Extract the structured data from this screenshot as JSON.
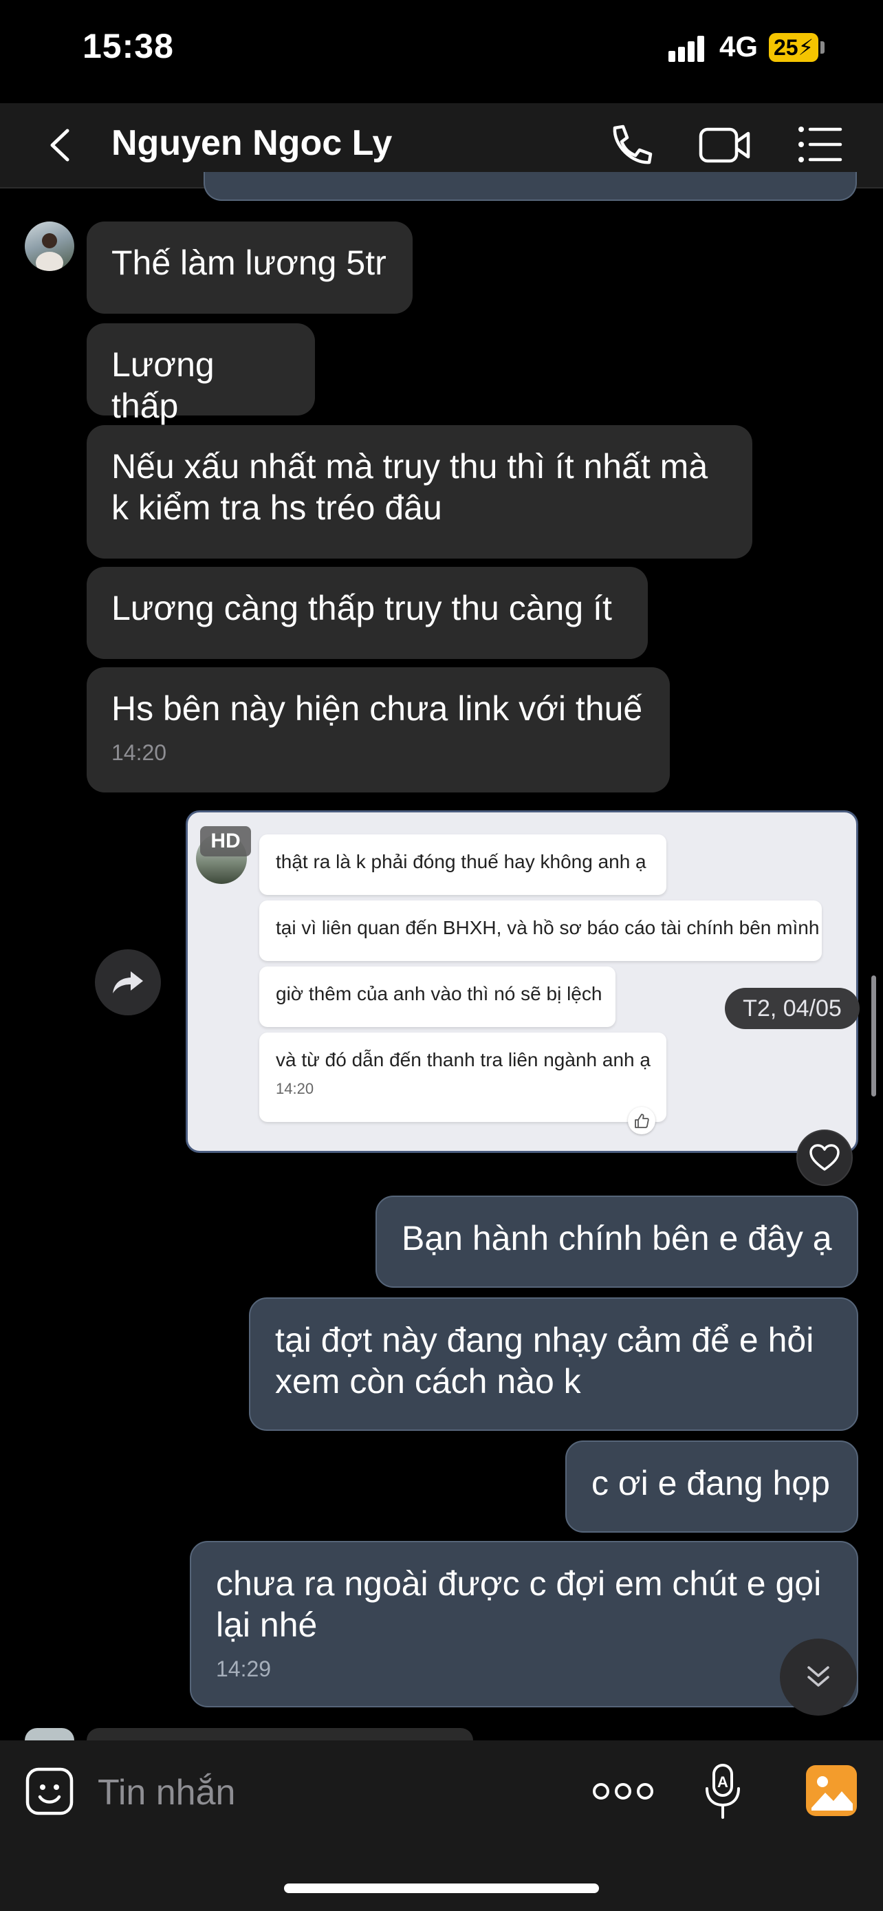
{
  "status_bar": {
    "time": "15:38",
    "network": "4G",
    "battery": "25"
  },
  "header": {
    "back_icon": "chevron-left-icon",
    "contact_name": "Nguyen Ngoc Ly",
    "call_icon": "phone-icon",
    "video_icon": "video-camera-icon",
    "menu_icon": "list-menu-icon"
  },
  "incoming": [
    {
      "text": "Thế làm lương 5tr"
    },
    {
      "text": "Lương thấp"
    },
    {
      "text": "Nếu xấu nhất mà truy thu thì ít nhất mà k kiểm tra hs tréo đâu"
    },
    {
      "text": "Lương càng thấp truy thu càng ít"
    },
    {
      "text": "Hs bên này hiện chưa link với thuế",
      "time": "14:20"
    }
  ],
  "forwarded": {
    "badge": "HD",
    "bubbles": [
      {
        "text": "thật ra là k phải đóng thuế hay không anh ạ"
      },
      {
        "text": "tại vì liên quan đến BHXH, và hồ sơ báo cáo tài chính bên mình"
      },
      {
        "text": "giờ thêm của anh vào thì nó sẽ bị lệch"
      },
      {
        "text": "và từ đó dẫn đến thanh tra liên ngành anh ạ",
        "time": "14:20"
      }
    ],
    "date_pill": "T2, 04/05"
  },
  "outgoing": [
    {
      "text": "Bạn hành chính bên e đây ạ"
    },
    {
      "text": "tại đợt này đang nhạy cảm để e hỏi xem còn cách nào k"
    },
    {
      "text": "c ơi e đang họp"
    },
    {
      "text": "chưa ra ngoài được c đợi em chút e gọi lại nhé",
      "time": "14:29"
    }
  ],
  "input_bar": {
    "placeholder": "Tin nhắn",
    "emoji_icon": "sticker-icon",
    "more_icon": "more-dots-icon",
    "mic_icon": "voice-microphone-icon",
    "image_icon": "gallery-image-icon"
  },
  "colors": {
    "background": "#000000",
    "header": "#1b1b1b",
    "incoming_bubble": "#2b2b2b",
    "outgoing_bubble": "#3a4554",
    "accent_orange": "#f39c2c",
    "battery": "#f5c400"
  }
}
